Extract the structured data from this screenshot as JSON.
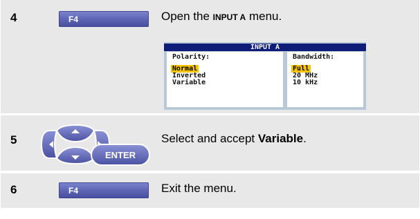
{
  "steps": [
    {
      "number": "4",
      "key_label": "F4",
      "text_before": "Open the ",
      "keyword": "INPUT A",
      "text_after": " menu."
    },
    {
      "number": "5",
      "enter_label": "ENTER",
      "text_before": "Select and accept ",
      "keyword": "Variable",
      "text_after": "."
    },
    {
      "number": "6",
      "key_label": "F4",
      "text": "Exit the menu."
    }
  ],
  "menu": {
    "title": "INPUT A",
    "polarity": {
      "header": "Polarity:",
      "options": [
        "Normal",
        "Inverted",
        "Variable"
      ],
      "selected": "Normal"
    },
    "bandwidth": {
      "header": "Bandwidth:",
      "options": [
        "Full",
        "20 MHz",
        "10 kHz"
      ],
      "selected": "Full"
    }
  },
  "colors": {
    "row_bg": "#e8e8e8",
    "fkey": "#5b63b2",
    "menu_title_bg": "#0f1c78",
    "menu_frame": "#b9c8d6",
    "highlight": "#f6c400"
  }
}
